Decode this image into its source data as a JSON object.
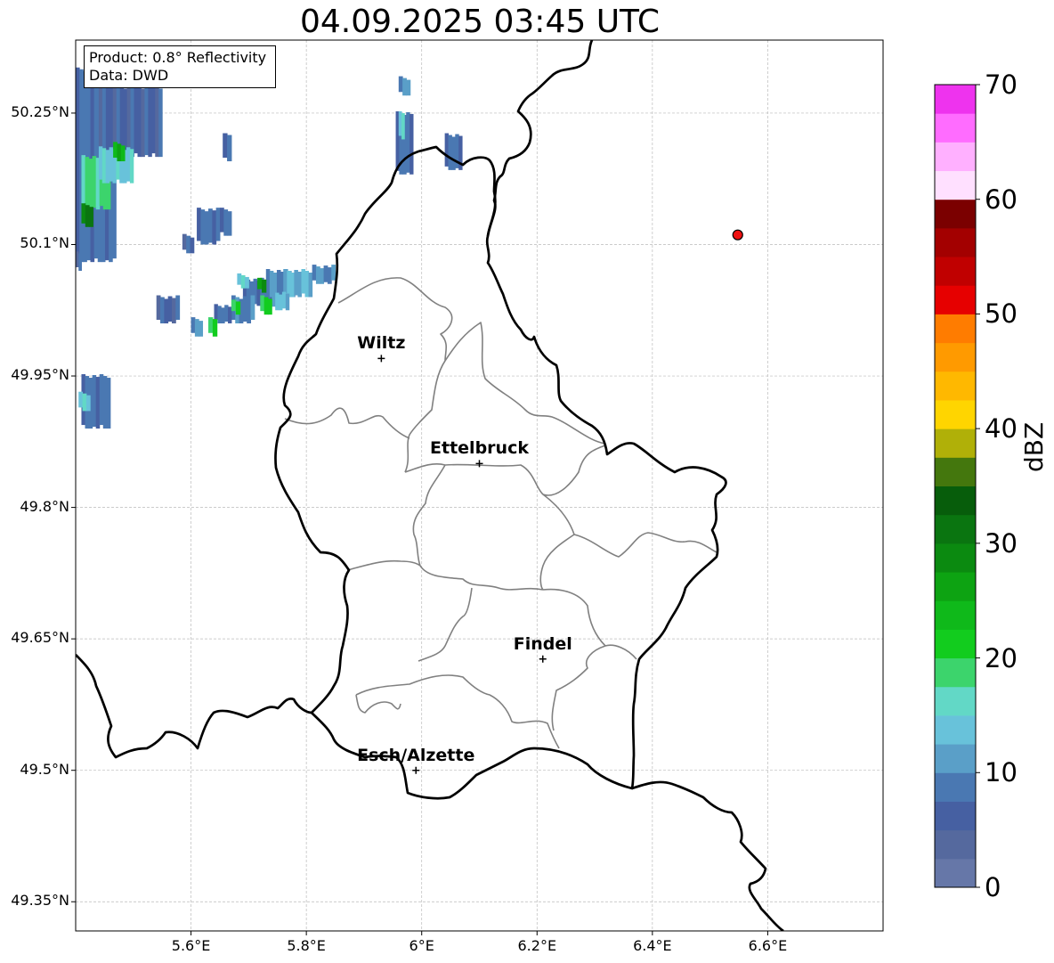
{
  "title": "04.09.2025 03:45 UTC",
  "info": {
    "product": "Product: 0.8° Reflectivity",
    "data": "Data: DWD"
  },
  "axes": {
    "lat_ticks": [
      {
        "value": 50.25,
        "label": "50.25°N"
      },
      {
        "value": 50.1,
        "label": "50.1°N"
      },
      {
        "value": 49.95,
        "label": "49.95°N"
      },
      {
        "value": 49.8,
        "label": "49.8°N"
      },
      {
        "value": 49.65,
        "label": "49.65°N"
      },
      {
        "value": 49.5,
        "label": "49.5°N"
      },
      {
        "value": 49.35,
        "label": "49.35°N"
      }
    ],
    "lon_ticks": [
      {
        "value": 5.6,
        "label": "5.6°E"
      },
      {
        "value": 5.8,
        "label": "5.8°E"
      },
      {
        "value": 6.0,
        "label": "6°E"
      },
      {
        "value": 6.2,
        "label": "6.2°E"
      },
      {
        "value": 6.4,
        "label": "6.4°E"
      },
      {
        "value": 6.6,
        "label": "6.6°E"
      }
    ]
  },
  "cities": [
    {
      "name": "Wiltz",
      "lon": 5.93,
      "lat": 49.97
    },
    {
      "name": "Ettelbruck",
      "lon": 6.1,
      "lat": 49.85
    },
    {
      "name": "Findel",
      "lon": 6.21,
      "lat": 49.627
    },
    {
      "name": "Esch/Alzette",
      "lon": 5.99,
      "lat": 49.5
    }
  ],
  "radar_site": {
    "lon": 6.548,
    "lat": 50.111,
    "color": "#ee1111"
  },
  "colorbar": {
    "label": "dBZ",
    "min": 0,
    "max": 70,
    "ticks": [
      {
        "value": 0,
        "label": "0"
      },
      {
        "value": 10,
        "label": "10"
      },
      {
        "value": 20,
        "label": "20"
      },
      {
        "value": 30,
        "label": "30"
      },
      {
        "value": 40,
        "label": "40"
      },
      {
        "value": 50,
        "label": "50"
      },
      {
        "value": 60,
        "label": "60"
      },
      {
        "value": 70,
        "label": "70"
      }
    ],
    "colors": [
      "#6677a8",
      "#55699e",
      "#4660a2",
      "#4a78b2",
      "#5a9fc8",
      "#68c2da",
      "#62d8c6",
      "#3cd46c",
      "#12cc1e",
      "#0fb91a",
      "#0da312",
      "#0b8a10",
      "#0a7510",
      "#075d0b",
      "#44770d",
      "#b0b008",
      "#ffd500",
      "#ffb800",
      "#ff9a00",
      "#ff7c00",
      "#e60000",
      "#c00000",
      "#a30000",
      "#7b0000",
      "#ffe0ff",
      "#ffb0ff",
      "#ff6cff",
      "#ee33ee"
    ]
  },
  "radar_echoes": [
    {
      "lon": 5.4,
      "lat": 50.3,
      "w": 0.07,
      "h": 0.22,
      "dbz": 8
    },
    {
      "lon": 5.44,
      "lat": 50.28,
      "w": 0.11,
      "h": 0.08,
      "dbz": 6
    },
    {
      "lon": 5.41,
      "lat": 50.2,
      "w": 0.05,
      "h": 0.06,
      "dbz": 18
    },
    {
      "lon": 5.44,
      "lat": 50.21,
      "w": 0.06,
      "h": 0.04,
      "dbz": 14
    },
    {
      "lon": 5.41,
      "lat": 50.145,
      "w": 0.02,
      "h": 0.025,
      "dbz": 30
    },
    {
      "lon": 5.465,
      "lat": 50.215,
      "w": 0.02,
      "h": 0.02,
      "dbz": 24
    },
    {
      "lon": 5.4,
      "lat": 50.09,
      "w": 0.01,
      "h": 0.02,
      "dbz": 6
    },
    {
      "lon": 5.41,
      "lat": 49.95,
      "w": 0.05,
      "h": 0.06,
      "dbz": 8
    },
    {
      "lon": 5.405,
      "lat": 49.93,
      "w": 0.02,
      "h": 0.02,
      "dbz": 14
    },
    {
      "lon": 5.54,
      "lat": 50.04,
      "w": 0.04,
      "h": 0.03,
      "dbz": 6
    },
    {
      "lon": 5.69,
      "lat": 50.06,
      "w": 0.06,
      "h": 0.03,
      "dbz": 8
    },
    {
      "lon": 5.73,
      "lat": 50.07,
      "w": 0.05,
      "h": 0.03,
      "dbz": 10
    },
    {
      "lon": 5.76,
      "lat": 50.07,
      "w": 0.05,
      "h": 0.03,
      "dbz": 12
    },
    {
      "lon": 5.81,
      "lat": 50.075,
      "w": 0.04,
      "h": 0.02,
      "dbz": 10
    },
    {
      "lon": 5.67,
      "lat": 50.04,
      "w": 0.04,
      "h": 0.03,
      "dbz": 9
    },
    {
      "lon": 5.64,
      "lat": 50.03,
      "w": 0.03,
      "h": 0.02,
      "dbz": 8
    },
    {
      "lon": 5.74,
      "lat": 50.045,
      "w": 0.03,
      "h": 0.02,
      "dbz": 13
    },
    {
      "lon": 5.72,
      "lat": 50.04,
      "w": 0.02,
      "h": 0.02,
      "dbz": 20
    },
    {
      "lon": 5.715,
      "lat": 50.06,
      "w": 0.015,
      "h": 0.015,
      "dbz": 28
    },
    {
      "lon": 5.67,
      "lat": 50.035,
      "w": 0.015,
      "h": 0.015,
      "dbz": 20
    },
    {
      "lon": 5.63,
      "lat": 50.015,
      "w": 0.015,
      "h": 0.02,
      "dbz": 20
    },
    {
      "lon": 5.68,
      "lat": 50.065,
      "w": 0.02,
      "h": 0.015,
      "dbz": 14
    },
    {
      "lon": 5.6,
      "lat": 50.015,
      "w": 0.02,
      "h": 0.02,
      "dbz": 10
    },
    {
      "lon": 5.61,
      "lat": 50.14,
      "w": 0.04,
      "h": 0.04,
      "dbz": 8
    },
    {
      "lon": 5.585,
      "lat": 50.11,
      "w": 0.02,
      "h": 0.02,
      "dbz": 6
    },
    {
      "lon": 5.65,
      "lat": 50.14,
      "w": 0.02,
      "h": 0.03,
      "dbz": 8
    },
    {
      "lon": 5.655,
      "lat": 50.225,
      "w": 0.015,
      "h": 0.03,
      "dbz": 8
    },
    {
      "lon": 5.955,
      "lat": 50.25,
      "w": 0.03,
      "h": 0.07,
      "dbz": 8
    },
    {
      "lon": 5.96,
      "lat": 50.29,
      "w": 0.02,
      "h": 0.02,
      "dbz": 10
    },
    {
      "lon": 5.96,
      "lat": 50.25,
      "w": 0.01,
      "h": 0.03,
      "dbz": 14
    },
    {
      "lon": 6.04,
      "lat": 50.225,
      "w": 0.03,
      "h": 0.04,
      "dbz": 8
    },
    {
      "lon": 5.5,
      "lat": 50.3,
      "w": 0.035,
      "h": 0.01,
      "dbz": 6
    }
  ]
}
